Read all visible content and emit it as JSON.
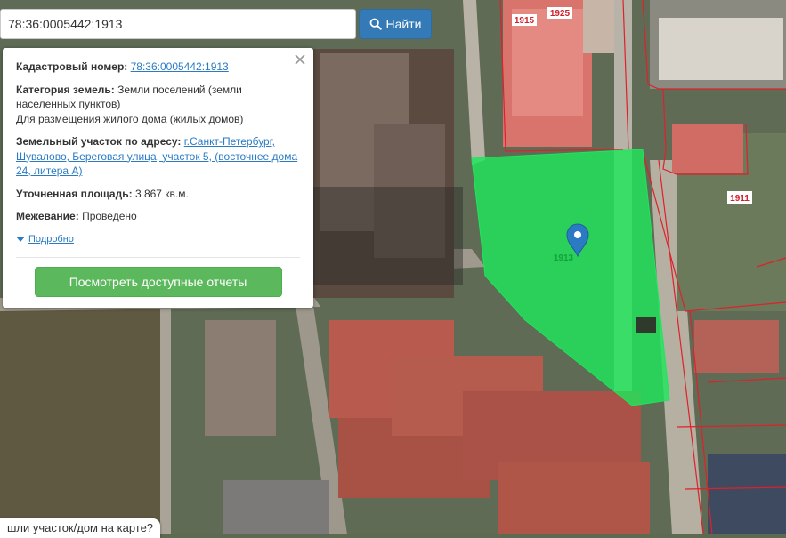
{
  "search": {
    "query": "78:36:0005442:1913",
    "button_label": "Найти"
  },
  "popup": {
    "cadastral_label": "Кадастровый номер:",
    "cadastral_number": "78:36:0005442:1913",
    "category_label": "Категория земель:",
    "category_value": "Земли поселений (земли населенных пунктов)",
    "category_purpose": "Для размещения жилого дома (жилых домов)",
    "address_label": "Земельный участок по адресу:",
    "address_value": "г.Санкт-Петербург, Шувалово, Береговая улица, участок 5, (восточнее дома 24, литера А)",
    "area_label": "Уточненная площадь:",
    "area_value": "3 867 кв.м.",
    "survey_label": "Межевание:",
    "survey_value": "Проведено",
    "more_label": "Подробно",
    "reports_button": "Посмотреть доступные отчеты"
  },
  "map": {
    "parcel_labels": [
      "1915",
      "1925",
      "1911",
      "1913"
    ]
  },
  "bottom_tip": "шли участок/дом на карте?",
  "colors": {
    "parcel_fill": "#1ee65a",
    "boundary": "#e0202a",
    "search_button": "#337ab7",
    "report_button": "#5cb85c",
    "marker": "#2a7bc4"
  },
  "icons": [
    "search-icon",
    "close-icon",
    "location-marker-icon",
    "triangle-down-icon"
  ]
}
